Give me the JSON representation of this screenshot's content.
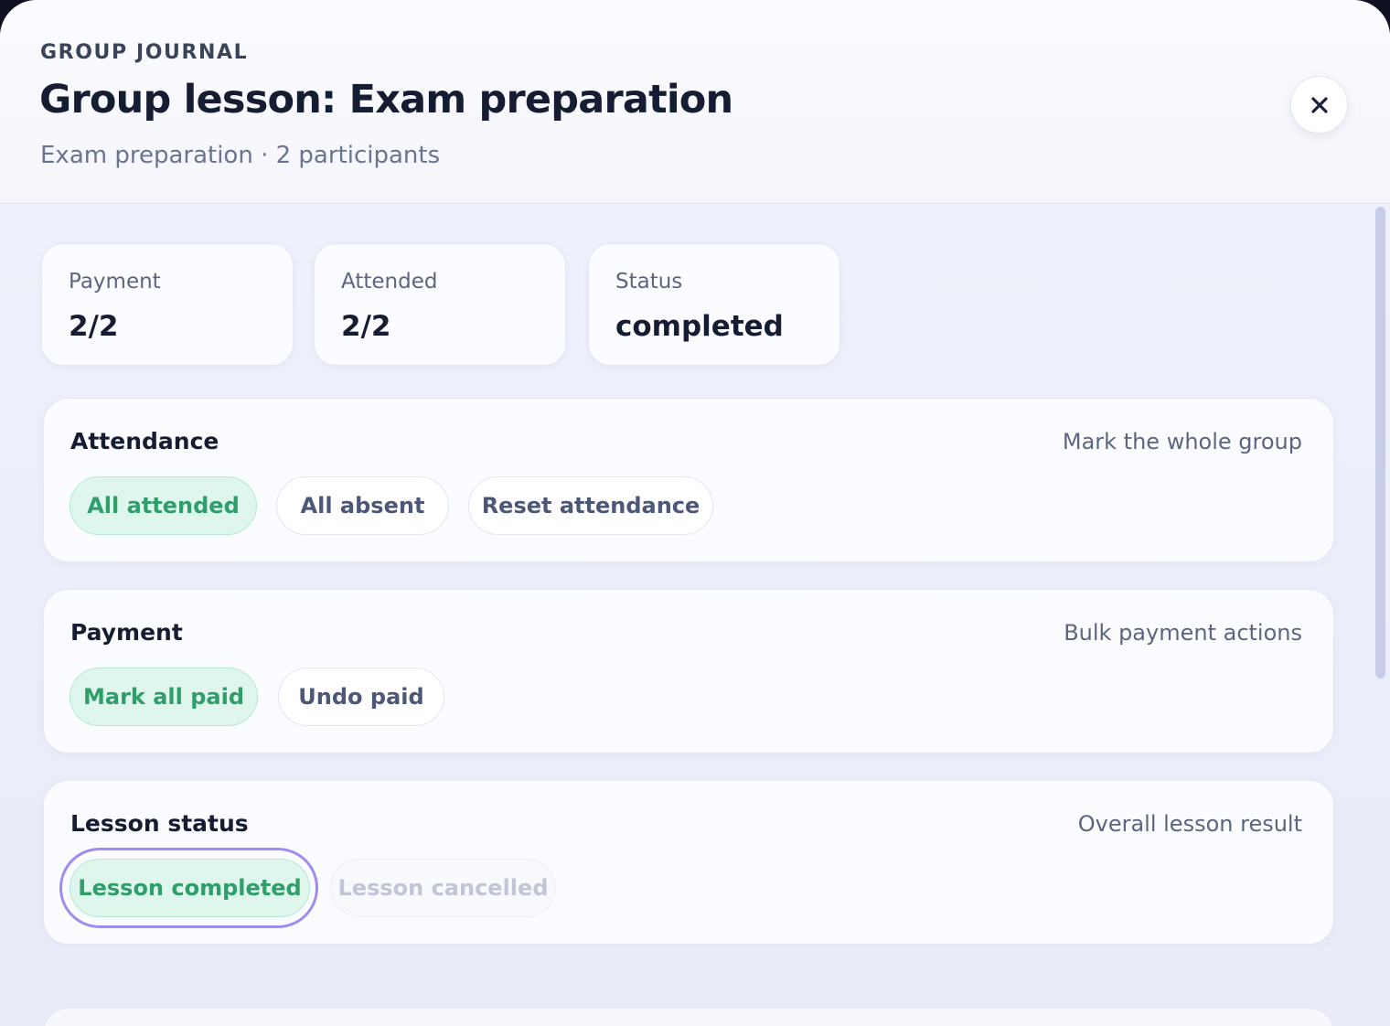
{
  "header": {
    "eyebrow": "GROUP JOURNAL",
    "title": "Group lesson: Exam preparation",
    "subtitle": "Exam preparation · 2 participants",
    "close_icon": "close-icon"
  },
  "stats": [
    {
      "label": "Payment",
      "value": "2/2"
    },
    {
      "label": "Attended",
      "value": "2/2"
    },
    {
      "label": "Status",
      "value": "completed"
    }
  ],
  "attendance": {
    "title": "Attendance",
    "hint": "Mark the whole group",
    "buttons": [
      "All attended",
      "All absent",
      "Reset attendance"
    ]
  },
  "payment": {
    "title": "Payment",
    "hint": "Bulk payment actions",
    "buttons": [
      "Mark all paid",
      "Undo paid"
    ]
  },
  "lesson_status": {
    "title": "Lesson status",
    "hint": "Overall lesson result",
    "buttons": [
      "Lesson completed",
      "Lesson cancelled"
    ],
    "selected": "Lesson completed"
  },
  "colors": {
    "accent_green": "#2f9e6a",
    "focus_ring": "#a08cf0",
    "text_primary": "#161d33"
  }
}
